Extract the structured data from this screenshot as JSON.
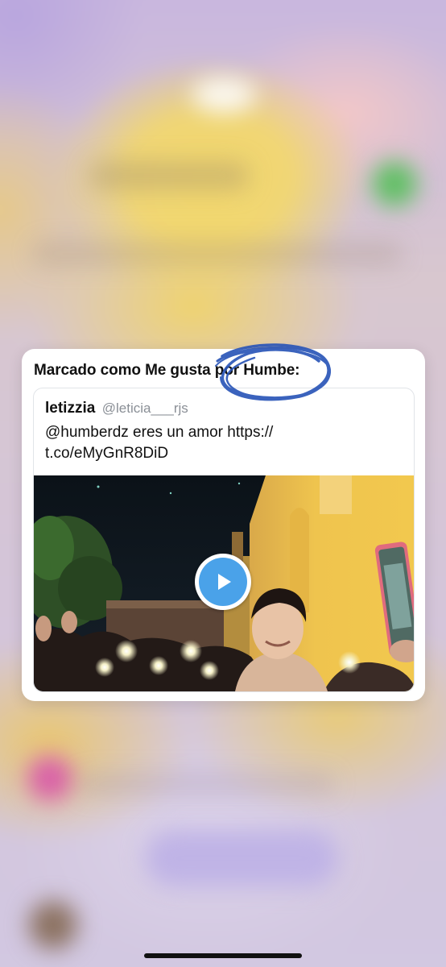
{
  "notification": {
    "header": "Marcado como Me gusta por Humbe:"
  },
  "tweet": {
    "name": "letizzia",
    "handle": "@leticia___rjs",
    "text": "@humberdz eres un amor https:// t.co/eMyGnR8DiD",
    "media": {
      "type": "video",
      "play_icon": "play-icon",
      "accent_color": "#4aa2e9"
    }
  },
  "annotation": {
    "color": "#2b56b8",
    "icon": "scribble-circle"
  },
  "colors": {
    "card_background": "#ffffff",
    "text_primary": "#111111",
    "text_secondary": "#8a8f96"
  }
}
